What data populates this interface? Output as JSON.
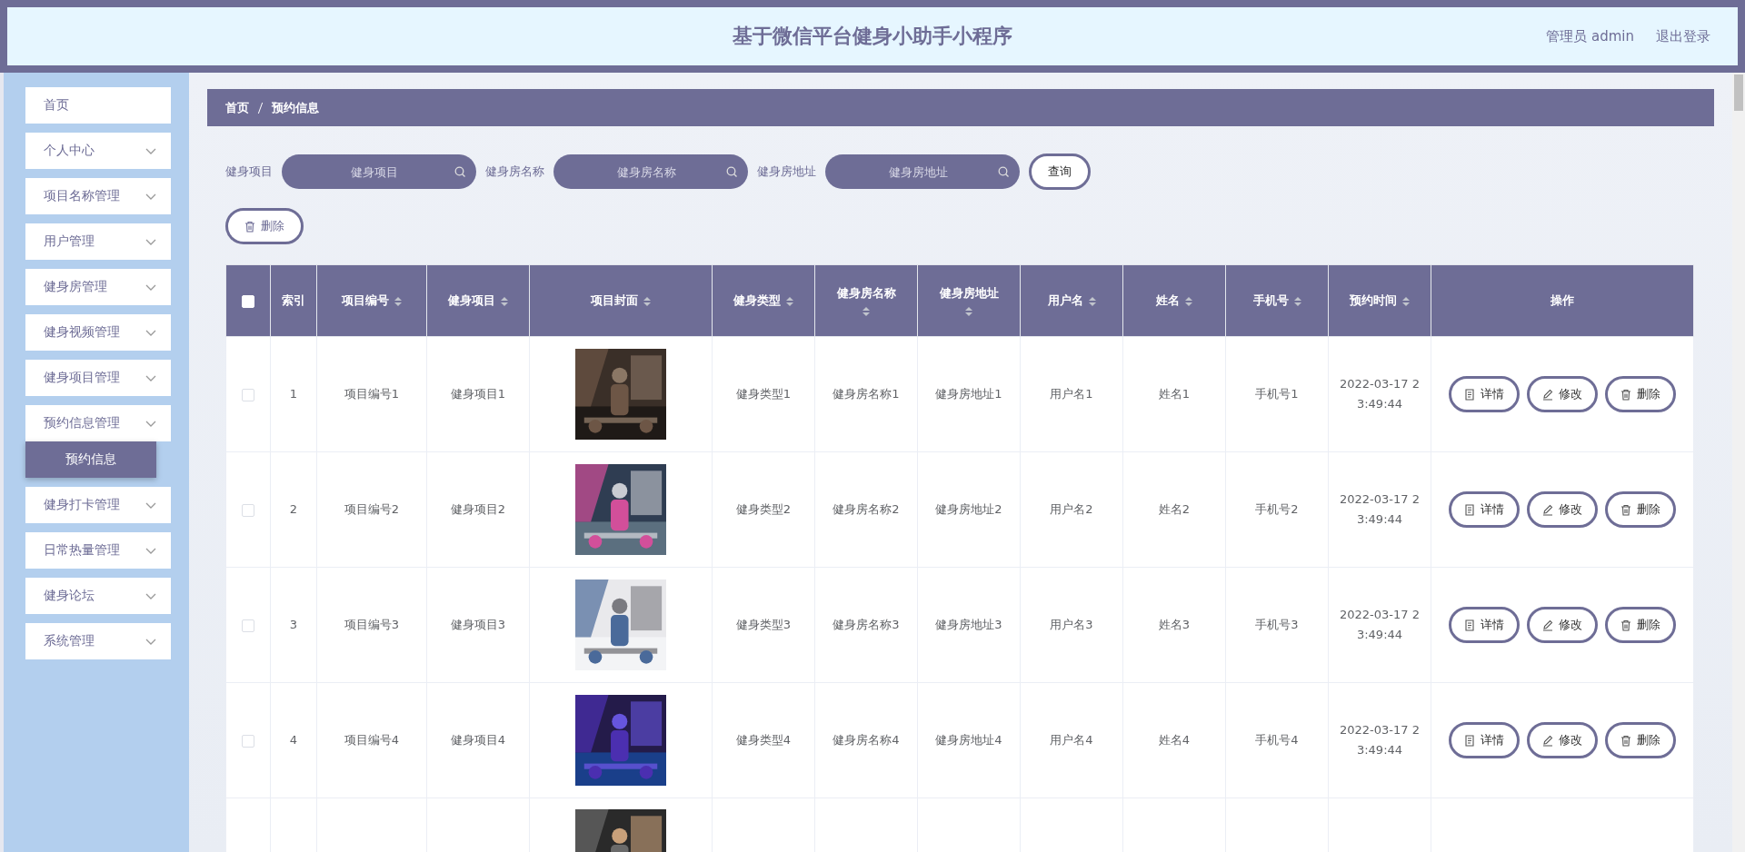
{
  "header": {
    "title": "基于微信平台健身小助手小程序",
    "user": "管理员 admin",
    "logout": "退出登录"
  },
  "sidebar": {
    "items": [
      {
        "label": "首页",
        "expandable": false
      },
      {
        "label": "个人中心",
        "expandable": true
      },
      {
        "label": "项目名称管理",
        "expandable": true
      },
      {
        "label": "用户管理",
        "expandable": true
      },
      {
        "label": "健身房管理",
        "expandable": true
      },
      {
        "label": "健身视频管理",
        "expandable": true
      },
      {
        "label": "健身项目管理",
        "expandable": true
      },
      {
        "label": "预约信息管理",
        "expandable": true,
        "expanded": true,
        "children": [
          {
            "label": "预约信息",
            "selected": true
          }
        ]
      },
      {
        "label": "健身打卡管理",
        "expandable": true
      },
      {
        "label": "日常热量管理",
        "expandable": true
      },
      {
        "label": "健身论坛",
        "expandable": true
      },
      {
        "label": "系统管理",
        "expandable": true
      }
    ]
  },
  "breadcrumb": [
    "首页",
    "预约信息"
  ],
  "search": {
    "fields": [
      {
        "label": "健身项目",
        "placeholder": "健身项目"
      },
      {
        "label": "健身房名称",
        "placeholder": "健身房名称"
      },
      {
        "label": "健身房地址",
        "placeholder": "健身房地址"
      }
    ],
    "button": "查询"
  },
  "delete_button": "删除",
  "table": {
    "header_checked": false,
    "columns": [
      {
        "label": "索引",
        "sortable": false
      },
      {
        "label": "项目编号",
        "sortable": true
      },
      {
        "label": "健身项目",
        "sortable": true
      },
      {
        "label": "项目封面",
        "sortable": true
      },
      {
        "label": "健身类型",
        "sortable": true
      },
      {
        "label": "健身房名称",
        "sortable": true
      },
      {
        "label": "健身房地址",
        "sortable": true
      },
      {
        "label": "用户名",
        "sortable": true
      },
      {
        "label": "姓名",
        "sortable": true
      },
      {
        "label": "手机号",
        "sortable": true
      },
      {
        "label": "预约时间",
        "sortable": true
      },
      {
        "label": "操作",
        "sortable": false
      }
    ],
    "rows": [
      {
        "checked": false,
        "cells": [
          "1",
          "项目编号1",
          "健身项目1",
          {
            "kind": "picture"
          },
          "健身类型1",
          "健身房名称1",
          "健身房地址1",
          "用户名1",
          "姓名1",
          "手机号1",
          "2022-03-17 23:49:44"
        ],
        "actions": [
          "详情",
          "修改",
          "删除"
        ]
      },
      {
        "checked": false,
        "cells": [
          "2",
          "项目编号2",
          "健身项目2",
          {
            "kind": "picture"
          },
          "健身类型2",
          "健身房名称2",
          "健身房地址2",
          "用户名2",
          "姓名2",
          "手机号2",
          "2022-03-17 23:49:44"
        ],
        "actions": [
          "详情",
          "修改",
          "删除"
        ]
      },
      {
        "checked": false,
        "cells": [
          "3",
          "项目编号3",
          "健身项目3",
          {
            "kind": "picture"
          },
          "健身类型3",
          "健身房名称3",
          "健身房地址3",
          "用户名3",
          "姓名3",
          "手机号3",
          "2022-03-17 23:49:44"
        ],
        "actions": [
          "详情",
          "修改",
          "删除"
        ]
      },
      {
        "checked": false,
        "cells": [
          "4",
          "项目编号4",
          "健身项目4",
          {
            "kind": "picture"
          },
          "健身类型4",
          "健身房名称4",
          "健身房地址4",
          "用户名4",
          "姓名4",
          "手机号4",
          "2022-03-17 23:49:44"
        ],
        "actions": [
          "详情",
          "修改",
          "删除"
        ]
      },
      {
        "partial": true,
        "cells": [
          {
            "kind": "picture"
          }
        ]
      }
    ]
  }
}
